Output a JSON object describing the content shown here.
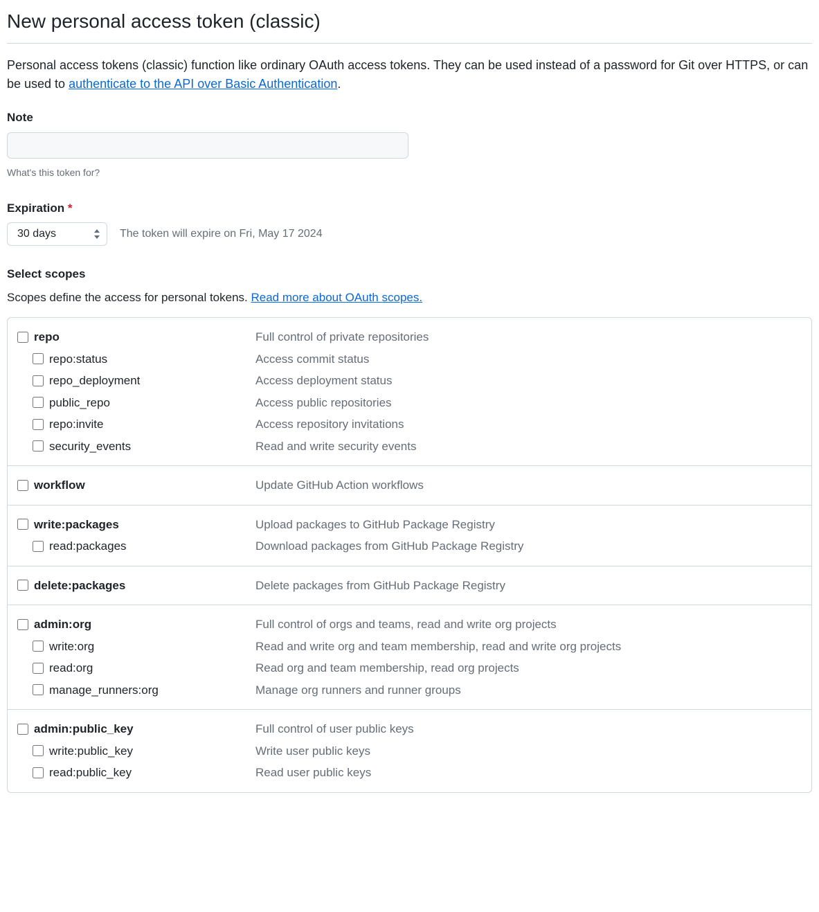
{
  "header": {
    "title": "New personal access token (classic)"
  },
  "description": {
    "text_before": "Personal access tokens (classic) function like ordinary OAuth access tokens. They can be used instead of a password for Git over HTTPS, or can be used to ",
    "link_text": "authenticate to the API over Basic Authentication",
    "text_after": "."
  },
  "note": {
    "label": "Note",
    "value": "",
    "hint": "What's this token for?"
  },
  "expiration": {
    "label": "Expiration",
    "required_marker": "*",
    "selected": "30 days",
    "expiry_text": "The token will expire on Fri, May 17 2024"
  },
  "scopes": {
    "label": "Select scopes",
    "hint_before": "Scopes define the access for personal tokens. ",
    "hint_link": "Read more about OAuth scopes.",
    "sections": [
      {
        "parent": {
          "name": "repo",
          "desc": "Full control of private repositories"
        },
        "children": [
          {
            "name": "repo:status",
            "desc": "Access commit status"
          },
          {
            "name": "repo_deployment",
            "desc": "Access deployment status"
          },
          {
            "name": "public_repo",
            "desc": "Access public repositories"
          },
          {
            "name": "repo:invite",
            "desc": "Access repository invitations"
          },
          {
            "name": "security_events",
            "desc": "Read and write security events"
          }
        ]
      },
      {
        "parent": {
          "name": "workflow",
          "desc": "Update GitHub Action workflows"
        },
        "children": []
      },
      {
        "parent": {
          "name": "write:packages",
          "desc": "Upload packages to GitHub Package Registry"
        },
        "children": [
          {
            "name": "read:packages",
            "desc": "Download packages from GitHub Package Registry"
          }
        ]
      },
      {
        "parent": {
          "name": "delete:packages",
          "desc": "Delete packages from GitHub Package Registry"
        },
        "children": []
      },
      {
        "parent": {
          "name": "admin:org",
          "desc": "Full control of orgs and teams, read and write org projects"
        },
        "children": [
          {
            "name": "write:org",
            "desc": "Read and write org and team membership, read and write org projects"
          },
          {
            "name": "read:org",
            "desc": "Read org and team membership, read org projects"
          },
          {
            "name": "manage_runners:org",
            "desc": "Manage org runners and runner groups"
          }
        ]
      },
      {
        "parent": {
          "name": "admin:public_key",
          "desc": "Full control of user public keys"
        },
        "children": [
          {
            "name": "write:public_key",
            "desc": "Write user public keys"
          },
          {
            "name": "read:public_key",
            "desc": "Read user public keys"
          }
        ]
      }
    ]
  }
}
